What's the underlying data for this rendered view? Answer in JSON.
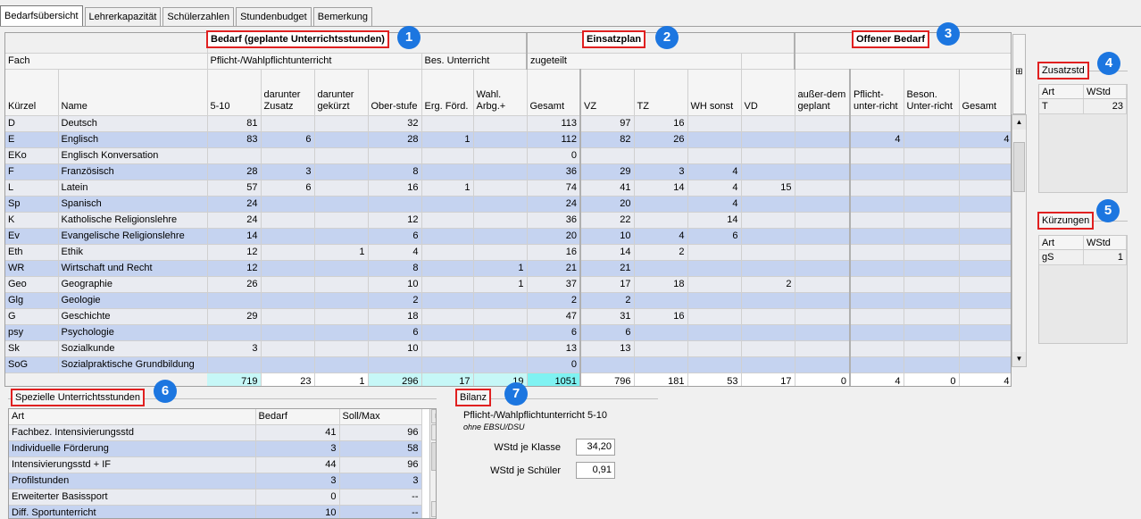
{
  "tabs": [
    "Bedarfsübersicht",
    "Lehrerkapazität",
    "Schülerzahlen",
    "Stundenbudget",
    "Bemerkung"
  ],
  "headers": {
    "bedarf": "Bedarf (geplante Unterrichtsstunden)",
    "einsatzplan": "Einsatzplan",
    "offener_bedarf": "Offener Bedarf",
    "fach": "Fach",
    "pflicht": "Pflicht-/Wahlpflichtunterricht",
    "bes_unterricht": "Bes. Unterricht",
    "zugeteilt": "zugeteilt",
    "kuerzel": "Kürzel",
    "name": "Name",
    "c510": "5-10",
    "dar_zusatz": "darunter Zusatz",
    "dar_gekuerzt": "darunter gekürzt",
    "oberstufe": "Ober-stufe",
    "erg_foerd": "Erg. Förd.",
    "wahl_arbg": "Wahl. Arbg.+",
    "gesamt": "Gesamt",
    "vz": "VZ",
    "tz": "TZ",
    "wh_sonst": "WH sonst",
    "vd": "VD",
    "ausserdem": "außer-dem geplant",
    "pflicht_unterricht": "Pflicht-unter-richt",
    "beson_unterricht": "Beson. Unter-richt",
    "gesamt2": "Gesamt"
  },
  "rows": [
    {
      "k": "D",
      "n": "Deutsch",
      "c510": "81",
      "z": "",
      "g": "",
      "ob": "32",
      "ef": "",
      "wa": "",
      "ges": "113",
      "vz": "97",
      "tz": "16",
      "wh": "",
      "vd": "",
      "ad": "",
      "op": "",
      "ob2": "",
      "og": ""
    },
    {
      "k": "E",
      "n": "Englisch",
      "c510": "83",
      "z": "6",
      "g": "",
      "ob": "28",
      "ef": "1",
      "wa": "",
      "ges": "112",
      "vz": "82",
      "tz": "26",
      "wh": "",
      "vd": "",
      "ad": "",
      "op": "4",
      "ob2": "",
      "og": "4"
    },
    {
      "k": "EKo",
      "n": "Englisch Konversation",
      "c510": "",
      "z": "",
      "g": "",
      "ob": "",
      "ef": "",
      "wa": "",
      "ges": "0",
      "vz": "",
      "tz": "",
      "wh": "",
      "vd": "",
      "ad": "",
      "op": "",
      "ob2": "",
      "og": ""
    },
    {
      "k": "F",
      "n": "Französisch",
      "c510": "28",
      "z": "3",
      "g": "",
      "ob": "8",
      "ef": "",
      "wa": "",
      "ges": "36",
      "vz": "29",
      "tz": "3",
      "wh": "4",
      "vd": "",
      "ad": "",
      "op": "",
      "ob2": "",
      "og": ""
    },
    {
      "k": "L",
      "n": "Latein",
      "c510": "57",
      "z": "6",
      "g": "",
      "ob": "16",
      "ef": "1",
      "wa": "",
      "ges": "74",
      "vz": "41",
      "tz": "14",
      "wh": "4",
      "vd": "15",
      "ad": "",
      "op": "",
      "ob2": "",
      "og": ""
    },
    {
      "k": "Sp",
      "n": "Spanisch",
      "c510": "24",
      "z": "",
      "g": "",
      "ob": "",
      "ef": "",
      "wa": "",
      "ges": "24",
      "vz": "20",
      "tz": "",
      "wh": "4",
      "vd": "",
      "ad": "",
      "op": "",
      "ob2": "",
      "og": ""
    },
    {
      "k": "K",
      "n": "Katholische Religionslehre",
      "c510": "24",
      "z": "",
      "g": "",
      "ob": "12",
      "ef": "",
      "wa": "",
      "ges": "36",
      "vz": "22",
      "tz": "",
      "wh": "14",
      "vd": "",
      "ad": "",
      "op": "",
      "ob2": "",
      "og": ""
    },
    {
      "k": "Ev",
      "n": "Evangelische Religionslehre",
      "c510": "14",
      "z": "",
      "g": "",
      "ob": "6",
      "ef": "",
      "wa": "",
      "ges": "20",
      "vz": "10",
      "tz": "4",
      "wh": "6",
      "vd": "",
      "ad": "",
      "op": "",
      "ob2": "",
      "og": ""
    },
    {
      "k": "Eth",
      "n": "Ethik",
      "c510": "12",
      "z": "",
      "g": "1",
      "ob": "4",
      "ef": "",
      "wa": "",
      "ges": "16",
      "vz": "14",
      "tz": "2",
      "wh": "",
      "vd": "",
      "ad": "",
      "op": "",
      "ob2": "",
      "og": ""
    },
    {
      "k": "WR",
      "n": "Wirtschaft und Recht",
      "c510": "12",
      "z": "",
      "g": "",
      "ob": "8",
      "ef": "",
      "wa": "1",
      "ges": "21",
      "vz": "21",
      "tz": "",
      "wh": "",
      "vd": "",
      "ad": "",
      "op": "",
      "ob2": "",
      "og": ""
    },
    {
      "k": "Geo",
      "n": "Geographie",
      "c510": "26",
      "z": "",
      "g": "",
      "ob": "10",
      "ef": "",
      "wa": "1",
      "ges": "37",
      "vz": "17",
      "tz": "18",
      "wh": "",
      "vd": "2",
      "ad": "",
      "op": "",
      "ob2": "",
      "og": ""
    },
    {
      "k": "Glg",
      "n": "Geologie",
      "c510": "",
      "z": "",
      "g": "",
      "ob": "2",
      "ef": "",
      "wa": "",
      "ges": "2",
      "vz": "2",
      "tz": "",
      "wh": "",
      "vd": "",
      "ad": "",
      "op": "",
      "ob2": "",
      "og": ""
    },
    {
      "k": "G",
      "n": "Geschichte",
      "c510": "29",
      "z": "",
      "g": "",
      "ob": "18",
      "ef": "",
      "wa": "",
      "ges": "47",
      "vz": "31",
      "tz": "16",
      "wh": "",
      "vd": "",
      "ad": "",
      "op": "",
      "ob2": "",
      "og": ""
    },
    {
      "k": "psy",
      "n": "Psychologie",
      "c510": "",
      "z": "",
      "g": "",
      "ob": "6",
      "ef": "",
      "wa": "",
      "ges": "6",
      "vz": "6",
      "tz": "",
      "wh": "",
      "vd": "",
      "ad": "",
      "op": "",
      "ob2": "",
      "og": ""
    },
    {
      "k": "Sk",
      "n": "Sozialkunde",
      "c510": "3",
      "z": "",
      "g": "",
      "ob": "10",
      "ef": "",
      "wa": "",
      "ges": "13",
      "vz": "13",
      "tz": "",
      "wh": "",
      "vd": "",
      "ad": "",
      "op": "",
      "ob2": "",
      "og": ""
    },
    {
      "k": "SoG",
      "n": "Sozialpraktische Grundbildung",
      "c510": "",
      "z": "",
      "g": "",
      "ob": "",
      "ef": "",
      "wa": "",
      "ges": "0",
      "vz": "",
      "tz": "",
      "wh": "",
      "vd": "",
      "ad": "",
      "op": "",
      "ob2": "",
      "og": ""
    }
  ],
  "totals": {
    "c510": "719",
    "z": "23",
    "g": "1",
    "ob": "296",
    "ef": "17",
    "wa": "19",
    "ges": "1051",
    "vz": "796",
    "tz": "181",
    "wh": "53",
    "vd": "17",
    "ad": "0",
    "op": "4",
    "ob2": "0",
    "og": "4"
  },
  "zusatzstd": {
    "title": "Zusatzstd",
    "col_art": "Art",
    "col_wstd": "WStd",
    "rows": [
      {
        "art": "T",
        "wstd": "23"
      }
    ]
  },
  "kuerzungen": {
    "title": "Kürzungen",
    "col_art": "Art",
    "col_wstd": "WStd",
    "rows": [
      {
        "art": "gS",
        "wstd": "1"
      }
    ]
  },
  "spezielle": {
    "title": "Spezielle Unterrichtsstunden",
    "col_art": "Art",
    "col_bedarf": "Bedarf",
    "col_soll": "Soll/Max",
    "rows": [
      {
        "art": "Fachbez. Intensivierungsstd",
        "bedarf": "41",
        "soll": "96"
      },
      {
        "art": "Individuelle Förderung",
        "bedarf": "3",
        "soll": "58"
      },
      {
        "art": "Intensivierungsstd + IF",
        "bedarf": "44",
        "soll": "96"
      },
      {
        "art": "Profilstunden",
        "bedarf": "3",
        "soll": "3"
      },
      {
        "art": "Erweiterter Basissport",
        "bedarf": "0",
        "soll": "--"
      },
      {
        "art": "Diff. Sportunterricht",
        "bedarf": "10",
        "soll": "--"
      }
    ]
  },
  "bilanz": {
    "title": "Bilanz",
    "subtitle": "Pflicht-/Wahlpflichtunterricht 5-10",
    "note": "ohne EBSU/DSU",
    "wstd_klasse_label": "WStd je Klasse",
    "wstd_klasse_value": "34,20",
    "wstd_schueler_label": "WStd je Schüler",
    "wstd_schueler_value": "0,91"
  },
  "badges": [
    "1",
    "2",
    "3",
    "4",
    "5",
    "6",
    "7"
  ],
  "colors": {
    "row_even": "#e9ebf1",
    "row_odd": "#c5d3f0",
    "total_cyan": "#c6f7f7",
    "total_cyan_strong": "#7ff2f2",
    "badge": "#1c76e0",
    "highlight": "#e02020"
  }
}
